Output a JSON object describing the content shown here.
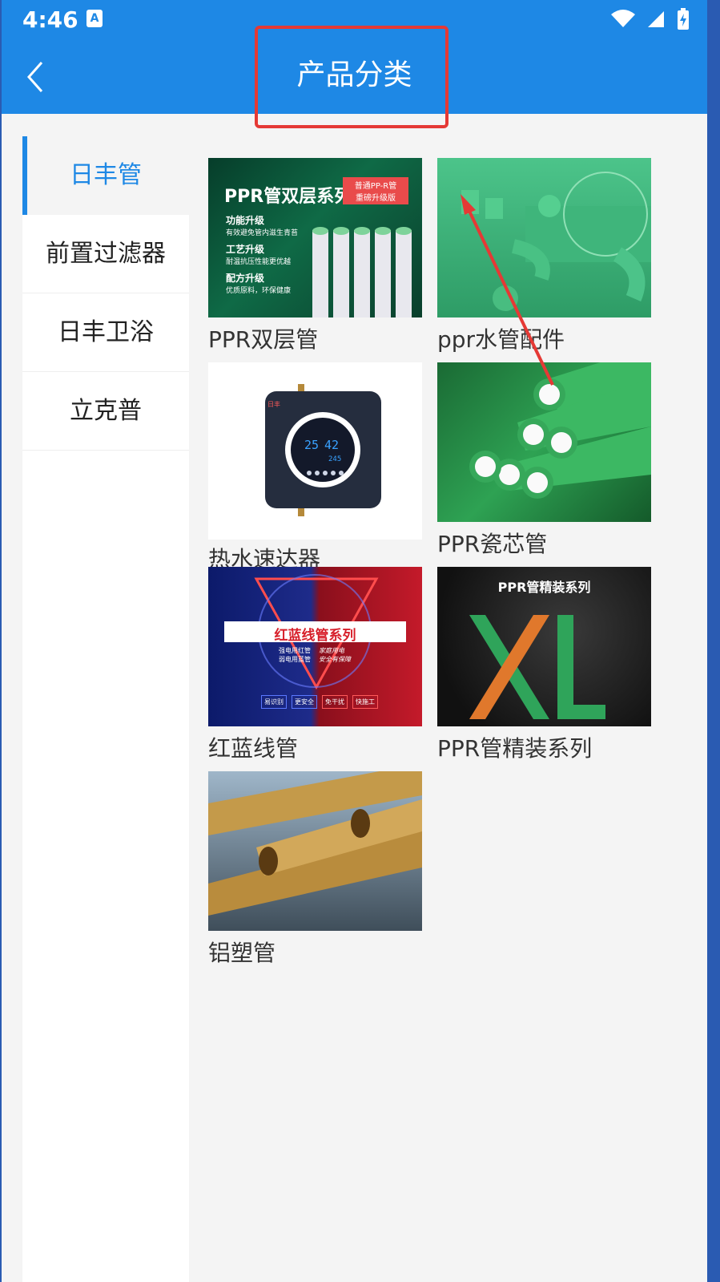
{
  "status": {
    "time": "4:46",
    "notif_badge": "A"
  },
  "header": {
    "title": "产品分类"
  },
  "sidebar": {
    "items": [
      {
        "label": "日丰管",
        "active": true
      },
      {
        "label": "前置过滤器",
        "active": false
      },
      {
        "label": "日丰卫浴",
        "active": false
      },
      {
        "label": "立克普",
        "active": false
      }
    ]
  },
  "products": [
    {
      "name": "PPR双层管",
      "thumb_text": [
        "PPR管双层系列",
        "普通PP-R管",
        "重磅升级版",
        "功能升级",
        "有效避免管内滋生青苔",
        "工艺升级",
        "耐温抗压性能更优越",
        "配方升级",
        "优质原料，环保健康"
      ]
    },
    {
      "name": "ppr水管配件"
    },
    {
      "name": "热水速达器",
      "thumb_text": [
        "日丰",
        "25",
        "42",
        "245"
      ]
    },
    {
      "name": "PPR瓷芯管"
    },
    {
      "name": "红蓝线管",
      "thumb_text": [
        "红蓝线管系列",
        "强电用红管",
        "弱电用蓝管",
        "家庭用电",
        "安全有保障",
        "易识别",
        "更安全",
        "免干扰",
        "快施工"
      ]
    },
    {
      "name": "PPR管精装系列",
      "thumb_text": [
        "PPR管精装系列",
        "XL"
      ]
    },
    {
      "name": "铝塑管"
    }
  ],
  "colors": {
    "primary": "#1e88e5",
    "highlight": "#e53935",
    "background": "#f4f4f4"
  },
  "icons": {
    "back": "chevron-left-icon",
    "wifi": "wifi-icon",
    "signal": "signal-icon",
    "battery": "battery-icon"
  }
}
